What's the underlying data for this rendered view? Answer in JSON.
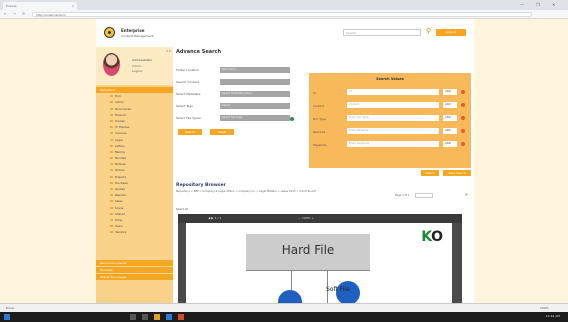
{
  "browser": {
    "tab_title": "Ecaves",
    "tab_close": "×",
    "window_buttons": [
      "—",
      "❐",
      "✕"
    ],
    "nav_icons": [
      "←",
      "→",
      "⟳"
    ],
    "url": "http://localhost/ecm"
  },
  "header": {
    "brand_line1": "Enterprise",
    "brand_line2": "Content Management",
    "search_placeholder": "Search",
    "search_icon": "search-icon",
    "button_label": "Logout"
  },
  "profile": {
    "name": "Administrator",
    "line2": "Admin",
    "line3": "Logout",
    "close": "✕✕"
  },
  "tree": {
    "root": "Repository",
    "items": [
      "Ecm",
      "Admin",
      "Documents",
      "Finance",
      "Human",
      "Hr Policies",
      "Invoices",
      "Legal",
      "Letters",
      "Memos",
      "Minutes",
      "Notices",
      "Orders",
      "Projects",
      "Purchase",
      "Quotes",
      "Reports",
      "Sales",
      "Scans",
      "Shared",
      "Temp",
      "Users",
      "Vendors",
      "Work"
    ],
    "footer1": "Recent Documents",
    "footer2": "Favorites",
    "footer3": "Shared Documents"
  },
  "advance_search": {
    "title": "Advance Search",
    "fields": [
      {
        "label": "Folder Location",
        "value": "Repository"
      },
      {
        "label": "Search Content",
        "value": ""
      },
      {
        "label": "Select Metadata",
        "value": "Select Metadata Group"
      },
      {
        "label": "Select Tags",
        "value": "Select"
      },
      {
        "label": "Select File Types",
        "value": "Select File Type"
      }
    ],
    "btn_search": "Search",
    "btn_reset": "Reset"
  },
  "search_values": {
    "title": "Search Values",
    "rows": [
      {
        "label": "Id",
        "placeholder": "Id",
        "op": "AND"
      },
      {
        "label": "Content",
        "placeholder": "Content",
        "op": "AND"
      },
      {
        "label": "Doc Type",
        "placeholder": "Enter Doc Type",
        "op": "AND"
      },
      {
        "label": "Remarks",
        "placeholder": "Enter Remarks",
        "op": "AND"
      },
      {
        "label": "Keywords",
        "placeholder": "Enter Keywords",
        "op": "AND"
      }
    ],
    "btn_search": "Search",
    "btn_save": "Save Search"
  },
  "repository_browser": {
    "title": "Repository Browser",
    "breadcrumb": "Repository > EBP > Company & Legal Affairs > Company Inc > Legal Matters > Lease 2015 > Hard File.pdf",
    "pager": "Page 1 of 1",
    "select_all": "Select All"
  },
  "viewer": {
    "toolbar_left": "◀ ▶  1 / 1",
    "toolbar_mid": "—  100%  +",
    "logo_k": "K",
    "logo_o": "O",
    "doc_title": "Hard File",
    "doc_small": "Soft File"
  },
  "status": {
    "left": "Done",
    "right": "100%"
  },
  "taskbar": {
    "time": "10:42 AM"
  }
}
